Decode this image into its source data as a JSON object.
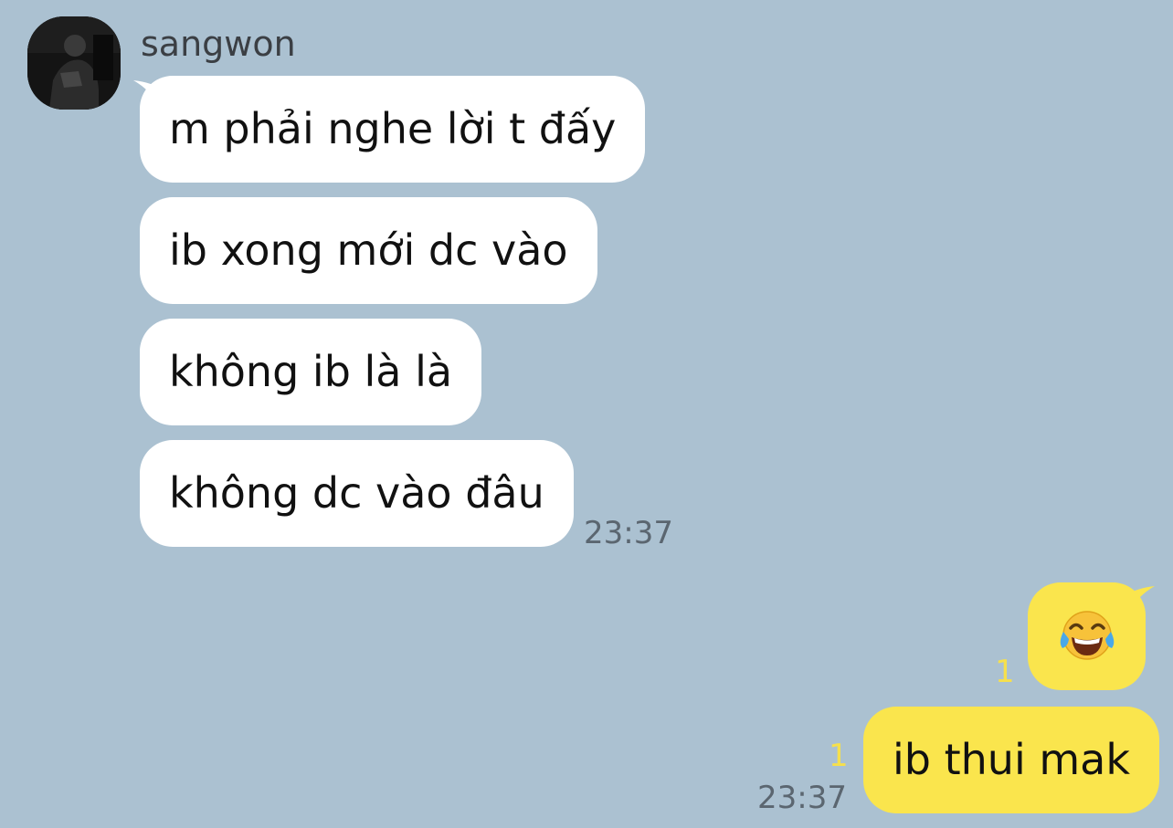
{
  "conversation": {
    "sender": {
      "name": "sangwon"
    },
    "incoming": [
      {
        "text": "m phải nghe lời t đấy"
      },
      {
        "text": "ib xong mới dc vào"
      },
      {
        "text": "không ib là là"
      },
      {
        "text": "không dc vào đâu"
      }
    ],
    "incoming_time": "23:37",
    "outgoing": [
      {
        "emoji": "face-with-tears-of-joy",
        "unread": "1"
      },
      {
        "text": "ib thui mak",
        "unread": "1"
      }
    ],
    "outgoing_time": "23:37"
  },
  "colors": {
    "background": "#abc1d1",
    "incoming_bubble": "#ffffff",
    "outgoing_bubble": "#fae54d",
    "unread_count": "#f6e04c",
    "timestamp": "#5b6670"
  }
}
